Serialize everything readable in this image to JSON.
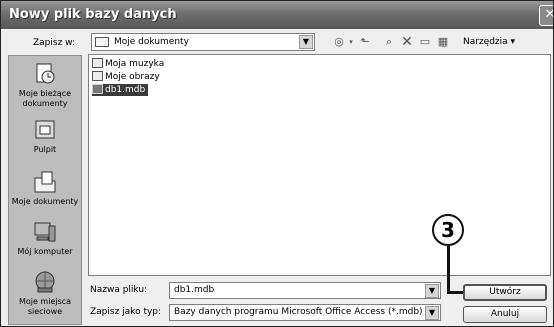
{
  "window": {
    "title": "Nowy plik bazy danych",
    "close_glyph": "✕"
  },
  "toolbar": {
    "save_in_label": "Zapisz w:",
    "save_in_value": "Moje dokumenty",
    "tools_label": "Narzędzia ▾",
    "icons": [
      "back-icon",
      "up-folder-icon",
      "search-web-icon",
      "delete-icon",
      "new-folder-icon",
      "views-icon"
    ]
  },
  "places": [
    {
      "id": "recent",
      "label": "Moje bieżące dokumenty",
      "icon": "recent-documents-icon"
    },
    {
      "id": "desktop",
      "label": "Pulpit",
      "icon": "desktop-icon"
    },
    {
      "id": "documents",
      "label": "Moje dokumenty",
      "icon": "my-documents-icon"
    },
    {
      "id": "computer",
      "label": "Mój komputer",
      "icon": "my-computer-icon"
    },
    {
      "id": "network",
      "label": "Moje miejsca sieciowe",
      "icon": "network-places-icon"
    }
  ],
  "files": [
    {
      "name": "Moja muzyka",
      "type": "folder",
      "selected": false
    },
    {
      "name": "Moje obrazy",
      "type": "folder",
      "selected": false
    },
    {
      "name": "db1.mdb",
      "type": "database",
      "selected": true
    }
  ],
  "filename": {
    "label": "Nazwa pliku:",
    "value": "db1.mdb"
  },
  "filetype": {
    "label": "Zapisz jako typ:",
    "value": "Bazy danych programu Microsoft Office Access (*.mdb)"
  },
  "buttons": {
    "create": "Utwórz",
    "cancel": "Anuluj"
  },
  "callout": {
    "number": "3"
  }
}
